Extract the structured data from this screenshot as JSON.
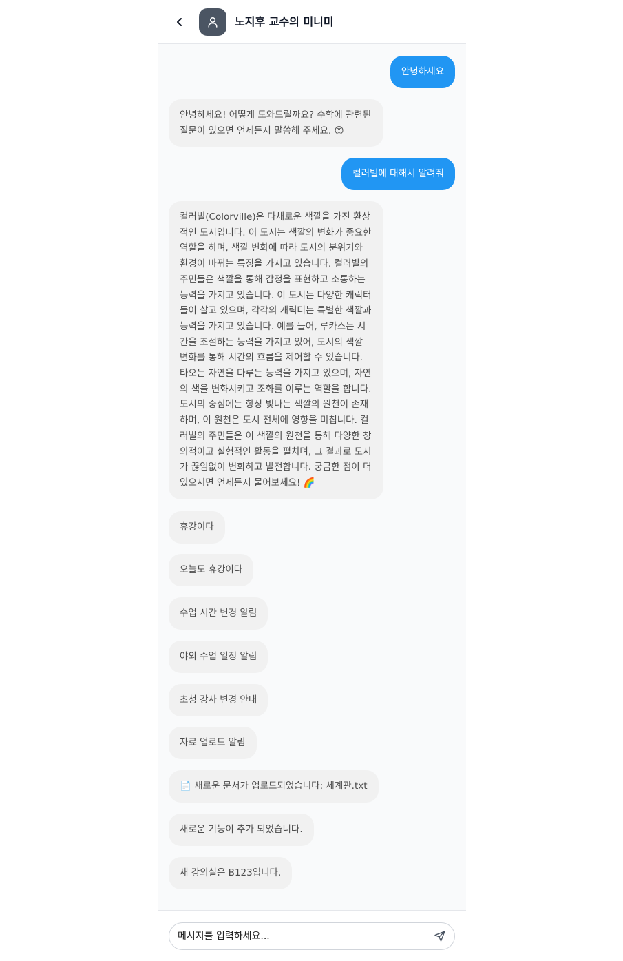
{
  "header": {
    "title": "노지후 교수의 미니미",
    "back_icon": "chevron-left-icon",
    "avatar_icon": "user-icon"
  },
  "messages": [
    {
      "role": "user",
      "text": "안녕하세요"
    },
    {
      "role": "bot",
      "text": "안녕하세요! 어떻게 도와드릴까요? 수학에 관련된 질문이 있으면 언제든지 말씀해 주세요. 😊"
    },
    {
      "role": "user",
      "text": "컬러빌에 대해서 알려줘"
    },
    {
      "role": "bot",
      "text": "컬러빌(Colorville)은 다채로운 색깔을 가진 환상적인 도시입니다. 이 도시는 색깔의 변화가 중요한 역할을 하며, 색깔 변화에 따라 도시의 분위기와 환경이 바뀌는 특징을 가지고 있습니다. 컬러빌의 주민들은 색깔을 통해 감정을 표현하고 소통하는 능력을 가지고 있습니다. 이 도시는 다양한 캐릭터들이 살고 있으며, 각각의 캐릭터는 특별한 색깔과 능력을 가지고 있습니다. 예를 들어, 루카스는 시간을 조절하는 능력을 가지고 있어, 도시의 색깔 변화를 통해 시간의 흐름을 제어할 수 있습니다. 타오는 자연을 다루는 능력을 가지고 있으며, 자연의 색을 변화시키고 조화를 이루는 역할을 합니다. 도시의 중심에는 항상 빛나는 색깔의 원천이 존재하며, 이 원천은 도시 전체에 영향을 미칩니다. 컬러빌의 주민들은 이 색깔의 원천을 통해 다양한 창의적이고 실험적인 활동을 펼치며, 그 결과로 도시가 끊임없이 변화하고 발전합니다. 궁금한 점이 더 있으시면 언제든지 물어보세요! 🌈"
    },
    {
      "role": "bot",
      "text": "휴강이다"
    },
    {
      "role": "bot",
      "text": "오늘도 휴강이다"
    },
    {
      "role": "bot",
      "text": "수업 시간 변경 알림"
    },
    {
      "role": "bot",
      "text": "야외 수업 일정 알림"
    },
    {
      "role": "bot",
      "text": "초청 강사 변경 안내"
    },
    {
      "role": "bot",
      "text": "자료 업로드 알림"
    },
    {
      "role": "bot",
      "text": "📄 새로운 문서가 업로드되었습니다: 세계관.txt"
    },
    {
      "role": "bot",
      "text": "새로운 기능이 추가 되었습니다."
    },
    {
      "role": "bot",
      "text": "새 강의실은 B123입니다."
    }
  ],
  "composer": {
    "placeholder": "메시지를 입력하세요...",
    "value": "",
    "send_icon": "send-icon"
  }
}
